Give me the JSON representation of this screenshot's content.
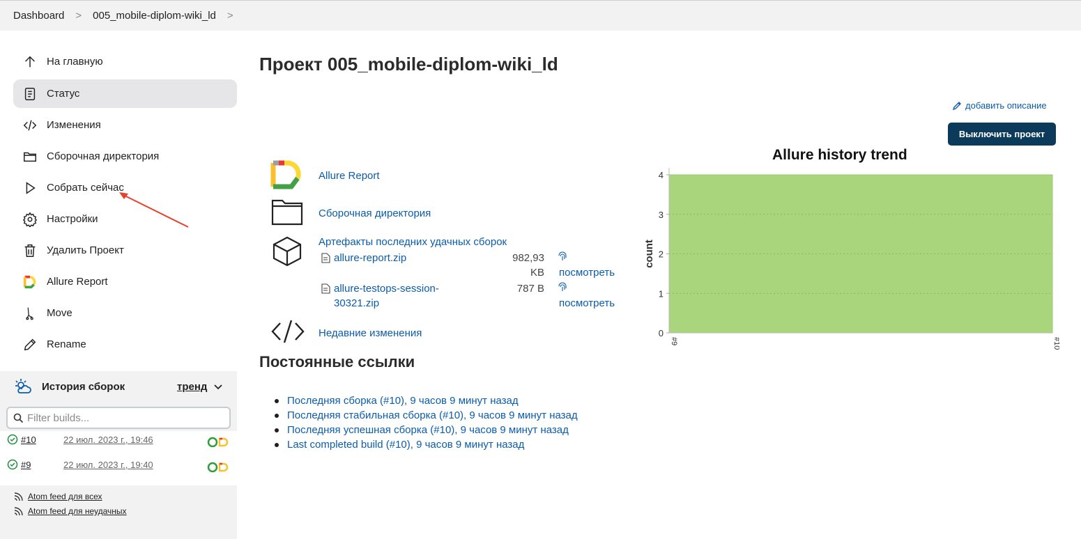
{
  "breadcrumb": {
    "items": [
      "Dashboard",
      "005_mobile-diplom-wiki_ld"
    ],
    "separator": ">"
  },
  "sidebar": {
    "items": [
      {
        "label": "На главную",
        "icon": "arrow-up-icon"
      },
      {
        "label": "Статус",
        "icon": "document-icon",
        "active": true
      },
      {
        "label": "Изменения",
        "icon": "code-icon"
      },
      {
        "label": "Сборочная директория",
        "icon": "folder-icon"
      },
      {
        "label": "Собрать сейчас",
        "icon": "play-icon"
      },
      {
        "label": "Настройки",
        "icon": "gear-icon"
      },
      {
        "label": "Удалить Проект",
        "icon": "trash-icon"
      },
      {
        "label": "Allure Report",
        "icon": "allure-logo-icon"
      },
      {
        "label": "Move",
        "icon": "move-icon"
      },
      {
        "label": "Rename",
        "icon": "pencil-icon"
      }
    ]
  },
  "history": {
    "title": "История сборок",
    "trend_label": "тренд",
    "filter_placeholder": "Filter builds...",
    "builds": [
      {
        "number": "#10",
        "date": "22 июл. 2023 г., 19:46",
        "status": "success"
      },
      {
        "number": "#9",
        "date": "22 июл. 2023 г., 19:40",
        "status": "success"
      }
    ],
    "feeds": [
      "Atom feed для всех",
      "Atom feed для неудачных"
    ]
  },
  "main": {
    "title": "Проект 005_mobile-diplom-wiki_ld",
    "add_description": "добавить описание",
    "disable_button": "Выключить проект",
    "links": {
      "allure": "Allure Report",
      "workspace": "Сборочная директория",
      "artifacts": "Артефакты последних удачных сборок",
      "changes": "Недавние изменения"
    },
    "artifacts": [
      {
        "name_line1": "allure-report.zip",
        "name_line2": "",
        "size_line1": "982,93",
        "size_line2": "KB",
        "view": "посмотреть"
      },
      {
        "name_line1": "allure-testops-session-",
        "name_line2": "30321.zip",
        "size_line1": "787 B",
        "size_line2": "",
        "view": "посмотреть"
      }
    ],
    "permalinks_title": "Постоянные ссылки",
    "permalinks": [
      "Последняя сборка (#10), 9 часов 9 минут назад",
      "Последняя стабильная сборка (#10), 9 часов 9 минут назад",
      "Последняя успешная сборка (#10), 9 часов 9 минут назад",
      "Last completed build (#10), 9 часов 9 минут назад"
    ]
  },
  "annotation": {
    "color": "#e8402a"
  },
  "chart_data": {
    "type": "area",
    "title": "Allure history trend",
    "categories": [
      "#9",
      "#10"
    ],
    "series": [
      {
        "values": [
          4,
          4
        ],
        "color": "#a9d57c"
      }
    ],
    "ylabel": "count",
    "xlabel": "",
    "ylim": [
      0,
      4
    ],
    "yticks": [
      0,
      1,
      2,
      3,
      4
    ],
    "grid": true
  }
}
